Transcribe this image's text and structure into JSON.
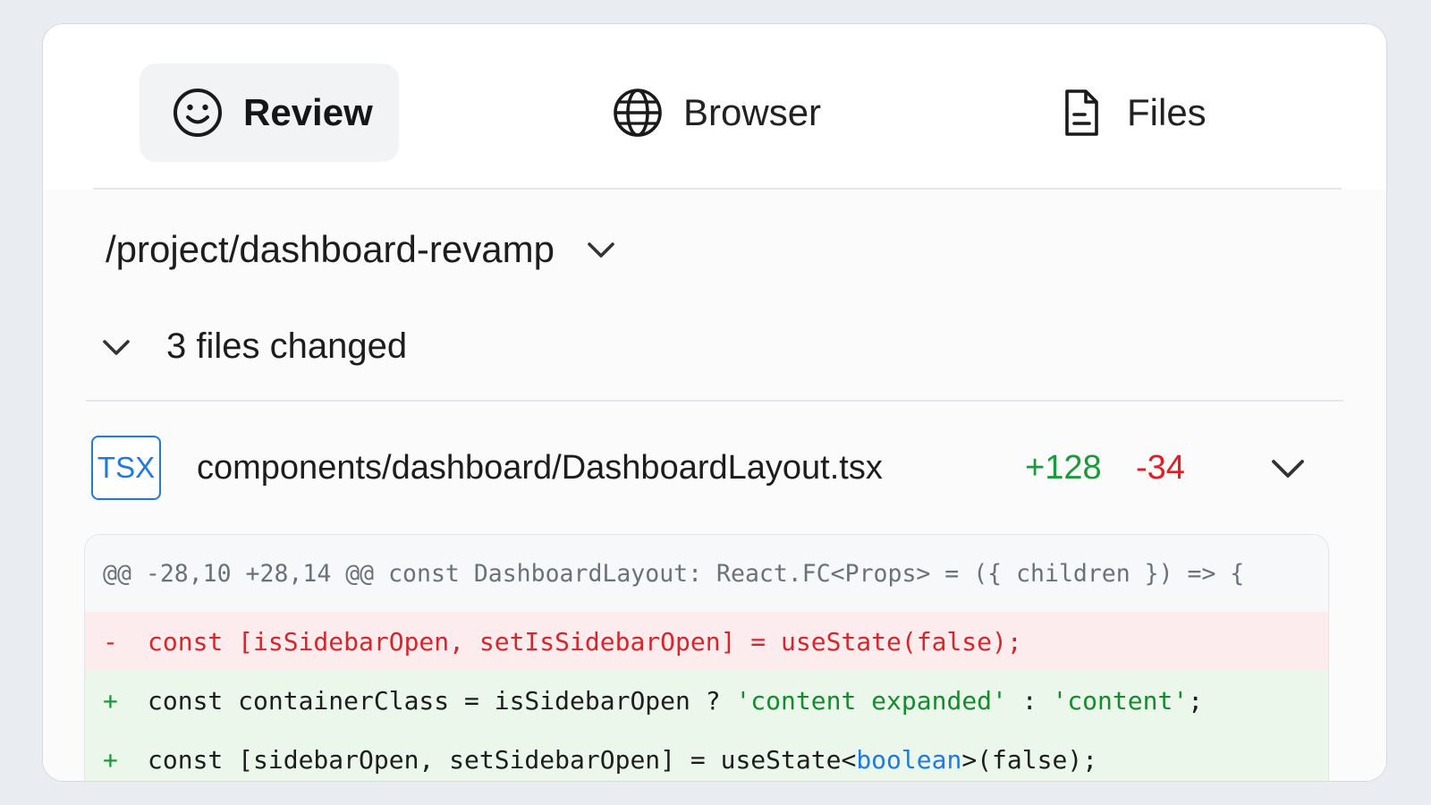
{
  "tabs": [
    {
      "label": "Review",
      "icon": "smiley-icon",
      "active": true
    },
    {
      "label": "Browser",
      "icon": "globe-icon",
      "active": false
    },
    {
      "label": "Files",
      "icon": "document-icon",
      "active": false
    }
  ],
  "project": {
    "path": "/project/dashboard-revamp"
  },
  "changes": {
    "summary": "3 files changed"
  },
  "file": {
    "badge": "TSX",
    "path": "components/dashboard/DashboardLayout.tsx",
    "additions": "+128",
    "deletions": "-34"
  },
  "diff": {
    "hunk_header": "@@ -28,10 +28,14 @@ const DashboardLayout: React.FC<Props> = ({ children }) => {",
    "lines": [
      {
        "sign": "-",
        "code": "const [isSidebarOpen, setIsSidebarOpen] = useState(false);"
      },
      {
        "sign": "+",
        "code_a": "const containerClass = isSidebarOpen ? ",
        "str1": "'content expanded'",
        "code_b": " : ",
        "str2": "'content'",
        "code_c": ";"
      },
      {
        "sign": "+",
        "code_a": "const [sidebarOpen, setSidebarOpen] = useState<",
        "type": "boolean",
        "code_b": ">(false);"
      }
    ]
  },
  "colors": {
    "accent": "#1f7ae0",
    "addition": "#1a9a3a",
    "deletion": "#e02020",
    "deleted_line_bg": "#fdecee",
    "added_line_bg": "#eaf7ea"
  }
}
